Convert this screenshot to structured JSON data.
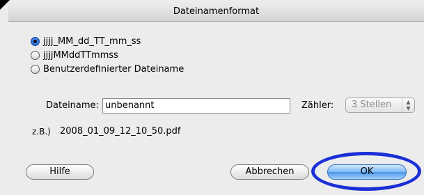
{
  "window": {
    "title": "Dateinamenformat"
  },
  "format_options": [
    {
      "label": "jjjj_MM_dd_TT_mm_ss",
      "selected": true
    },
    {
      "label": "jjjjMMddTTmmss",
      "selected": false
    },
    {
      "label": "Benutzerdefinierter Dateiname",
      "selected": false
    }
  ],
  "filename": {
    "label": "Dateiname:",
    "value": "unbenannt"
  },
  "counter": {
    "label": "Zähler:",
    "selected": "3 Stellen"
  },
  "example": {
    "label": "z.B.)",
    "value": "2008_01_09_12_10_50.pdf"
  },
  "buttons": {
    "help": "Hilfe",
    "cancel": "Abbrechen",
    "ok": "OK"
  },
  "colors": {
    "highlight_ring": "#1b2fd6",
    "default_button": "#4e97e8"
  }
}
